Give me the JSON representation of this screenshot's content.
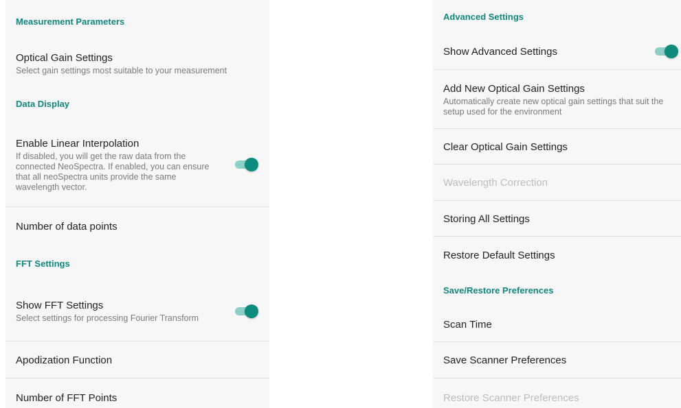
{
  "colors": {
    "accent": "#12867c",
    "toggle_on": "#0f8b7d",
    "panel_bg": "#f7f7f7",
    "disabled": "#bdbdbd"
  },
  "left": {
    "measurement_header": "Measurement Parameters",
    "optical_gain": {
      "title": "Optical Gain Settings",
      "subtitle": "Select gain settings most suitable to your measurement"
    },
    "data_display_header": "Data Display",
    "linear_interpolation": {
      "title": "Enable Linear Interpolation",
      "subtitle": "If disabled, you will get the raw data from the connected NeoSpectra. If enabled, you can ensure that all neoSpectra units provide the same wavelength vector.",
      "enabled": true
    },
    "data_points": {
      "title": "Number of data points"
    },
    "fft_header": "FFT Settings",
    "show_fft": {
      "title": "Show FFT Settings",
      "subtitle": "Select settings for processing Fourier Transform",
      "enabled": true
    },
    "apodization": {
      "title": "Apodization Function"
    },
    "fft_points": {
      "title": "Number of FFT Points"
    }
  },
  "right": {
    "advanced_header": "Advanced Settings",
    "show_advanced": {
      "title": "Show Advanced Settings",
      "enabled": true
    },
    "add_gain": {
      "title": "Add New Optical Gain Settings",
      "subtitle": "Automatically create new optical gain settings that suit the setup used for the environment"
    },
    "clear_gain": {
      "title": "Clear Optical Gain Settings"
    },
    "wavelength_correction": {
      "title": "Wavelength Correction",
      "disabled": true
    },
    "storing_all": {
      "title": "Storing All Settings"
    },
    "restore_default": {
      "title": "Restore Default Settings"
    },
    "save_restore_header": "Save/Restore Preferences",
    "scan_time": {
      "title": "Scan Time"
    },
    "save_scanner": {
      "title": "Save Scanner Preferences"
    },
    "restore_scanner": {
      "title": "Restore Scanner Preferences",
      "disabled": true
    }
  }
}
